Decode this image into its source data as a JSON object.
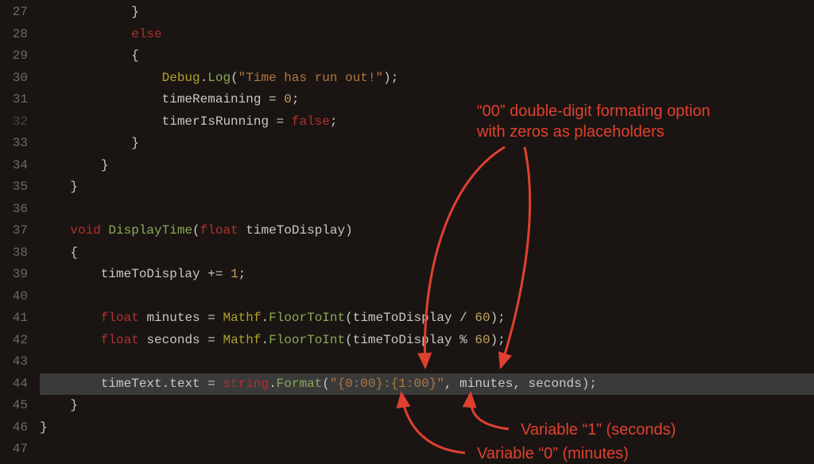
{
  "gutter": {
    "start": 27,
    "end": 47,
    "dim": 32
  },
  "code": {
    "l27": "            }",
    "l28_kw": "else",
    "l29": "            {",
    "l30": {
      "cls": "Debug",
      "fn": "Log",
      "arg": "\"Time has run out!\""
    },
    "l31": {
      "lhs": "timeRemaining",
      "rhs": "0"
    },
    "l32": {
      "lhs": "timerIsRunning",
      "rhs": "false"
    },
    "l33": "            }",
    "l34": "        }",
    "l35": "    }",
    "l37": {
      "kw": "void",
      "name": "DisplayTime",
      "ptype": "float",
      "pname": "timeToDisplay"
    },
    "l38": "    {",
    "l39": {
      "lhs": "timeToDisplay",
      "op": "+=",
      "rhs": "1"
    },
    "l41": {
      "type": "float",
      "name": "minutes",
      "cls": "Mathf",
      "fn": "FloorToInt",
      "arg1": "timeToDisplay",
      "op": "/",
      "arg2": "60"
    },
    "l42": {
      "type": "float",
      "name": "seconds",
      "cls": "Mathf",
      "fn": "FloorToInt",
      "arg1": "timeToDisplay",
      "op": "%",
      "arg2": "60"
    },
    "l44": {
      "obj": "timeText",
      "prop": "text",
      "cls": "string",
      "fn": "Format",
      "fmt": "\"{0:00}:{1:00}\"",
      "a1": "minutes",
      "a2": "seconds"
    },
    "l45": "    }",
    "l46": "}"
  },
  "annotations": {
    "top1": "“00” double-digit formating option",
    "top2": "with zeros as placeholders",
    "right": "Variable “1” (seconds)",
    "bottom": "Variable “0” (minutes)"
  }
}
